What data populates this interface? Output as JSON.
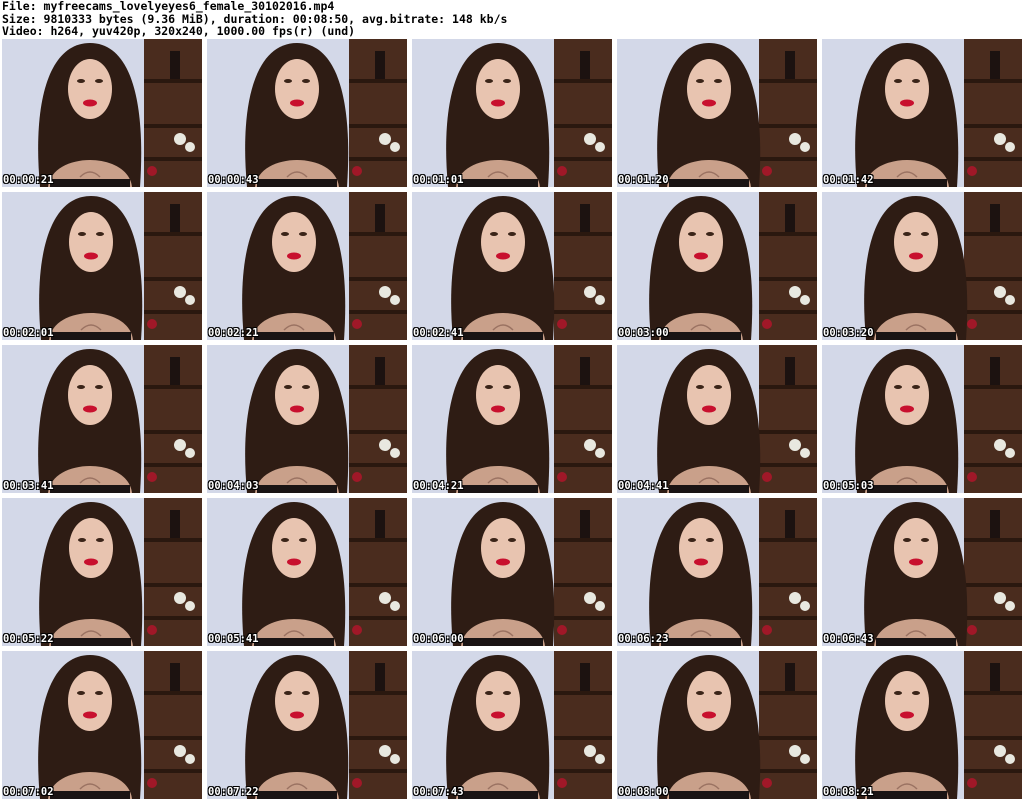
{
  "header": {
    "line1": "File: myfreecams_lovelyeyes6_female_30102016.mp4",
    "line2": "Size: 9810333 bytes (9.36 MiB), duration: 00:08:50, avg.bitrate: 148 kb/s",
    "line3": "Video: h264, yuv420p, 320x240, 1000.00 fps(r) (und)"
  },
  "thumbnails": [
    {
      "timestamp": "00:00:21"
    },
    {
      "timestamp": "00:00:43"
    },
    {
      "timestamp": "00:01:01"
    },
    {
      "timestamp": "00:01:20"
    },
    {
      "timestamp": "00:01:42"
    },
    {
      "timestamp": "00:02:01"
    },
    {
      "timestamp": "00:02:21"
    },
    {
      "timestamp": "00:02:41"
    },
    {
      "timestamp": "00:03:00"
    },
    {
      "timestamp": "00:03:20"
    },
    {
      "timestamp": "00:03:41"
    },
    {
      "timestamp": "00:04:03"
    },
    {
      "timestamp": "00:04:21"
    },
    {
      "timestamp": "00:04:41"
    },
    {
      "timestamp": "00:05:03"
    },
    {
      "timestamp": "00:05:22"
    },
    {
      "timestamp": "00:05:41"
    },
    {
      "timestamp": "00:06:00"
    },
    {
      "timestamp": "00:06:23"
    },
    {
      "timestamp": "00:06:43"
    },
    {
      "timestamp": "00:07:02"
    },
    {
      "timestamp": "00:07:22"
    },
    {
      "timestamp": "00:07:43"
    },
    {
      "timestamp": "00:08:00"
    },
    {
      "timestamp": "00:08:21"
    }
  ],
  "colors": {
    "wall": "#d3d8e8",
    "shelf": "#4a2c1e",
    "hair": "#2e1c14",
    "skin": "#e8c4b0",
    "lips": "#c8102e",
    "timestamp_text": "#ffffff"
  }
}
